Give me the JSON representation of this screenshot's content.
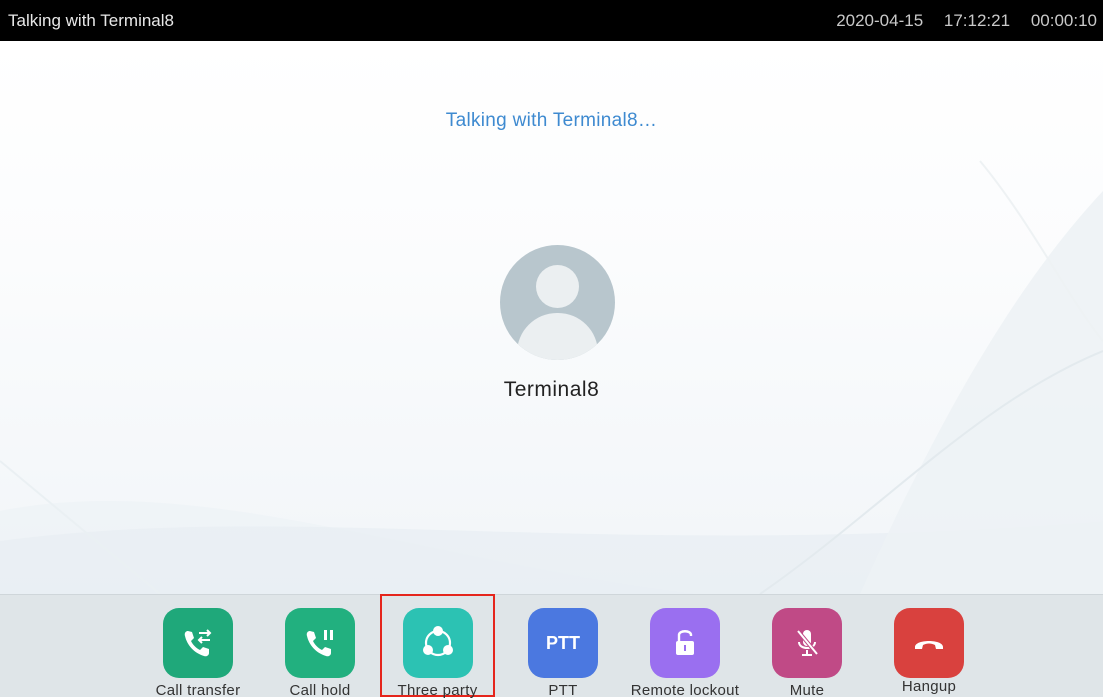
{
  "header": {
    "title": "Talking with Terminal8",
    "date": "2020-04-15",
    "time": "17:12:21",
    "call_duration": "00:00:10"
  },
  "call": {
    "status_text": "Talking with Terminal8…",
    "contact_name": "Terminal8"
  },
  "toolbar": {
    "buttons": [
      {
        "label": "Call transfer",
        "icon": "call-transfer-icon",
        "color": "#1fa87a"
      },
      {
        "label": "Call hold",
        "icon": "call-hold-icon",
        "color": "#22b07f"
      },
      {
        "label": "Three party",
        "icon": "three-party-icon",
        "color": "#2cc2b3",
        "selected": true
      },
      {
        "label": "PTT",
        "icon": "ptt-icon",
        "color": "#4b78e0",
        "icon_text": "PTT"
      },
      {
        "label": "Remote lockout",
        "icon": "unlock-icon",
        "color": "#9a6ff0"
      },
      {
        "label": "Mute",
        "icon": "mute-mic-icon",
        "color": "#c04a86"
      },
      {
        "label": "Hangup",
        "icon": "hangup-icon",
        "color": "#d9413e"
      }
    ]
  },
  "colors": {
    "accent_text": "#3e8ad0",
    "selection_outline": "#e5251c"
  }
}
